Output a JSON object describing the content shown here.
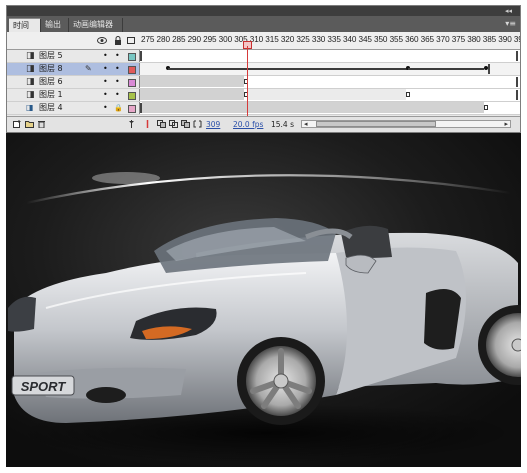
{
  "window": {
    "collapse_glyph": "◂◂",
    "menu_glyph": "▾≡"
  },
  "tabs": [
    {
      "label": "时间轴",
      "active": true
    },
    {
      "label": "输出",
      "active": false
    },
    {
      "label": "动画编辑器",
      "active": false
    }
  ],
  "header": {
    "eye_icon": "eye-icon",
    "lock_icon": "lock-icon",
    "outline_icon": "outline-icon",
    "frame_ruler": "275 280 285 290 295 300 305 310 315 320 325 330 335 340 345 350 355 360 365 370 375 380 385 390 39"
  },
  "layers": [
    {
      "name": "图层 5",
      "selected": false,
      "swatch": "#78c6c2",
      "locked": false,
      "pencil": false
    },
    {
      "name": "图层 8",
      "selected": true,
      "swatch": "#e05a5a",
      "locked": false,
      "pencil": true
    },
    {
      "name": "图层 6",
      "selected": false,
      "swatch": "#d98ad6",
      "locked": false,
      "pencil": false
    },
    {
      "name": "图层 1",
      "selected": false,
      "swatch": "#a7c24a",
      "locked": false,
      "pencil": false
    },
    {
      "name": "图层 4",
      "selected": false,
      "swatch": "#e7a7c9",
      "locked": true,
      "pencil": false
    }
  ],
  "glyphs": {
    "layer_icon": "◨",
    "pencil": "✎",
    "dot": "•",
    "lock": "🔒"
  },
  "footer": {
    "current_frame": "309",
    "fps": "20.0 fps",
    "time": "15.4 s",
    "scroll_left": "◂",
    "scroll_right": "▸"
  },
  "colors": {
    "selected_row": "#aebee0",
    "playhead": "#d63a3a",
    "stage_background": "#141414",
    "car_body": "#c9ccd0"
  },
  "stage": {
    "badge_text": "SPORT"
  }
}
